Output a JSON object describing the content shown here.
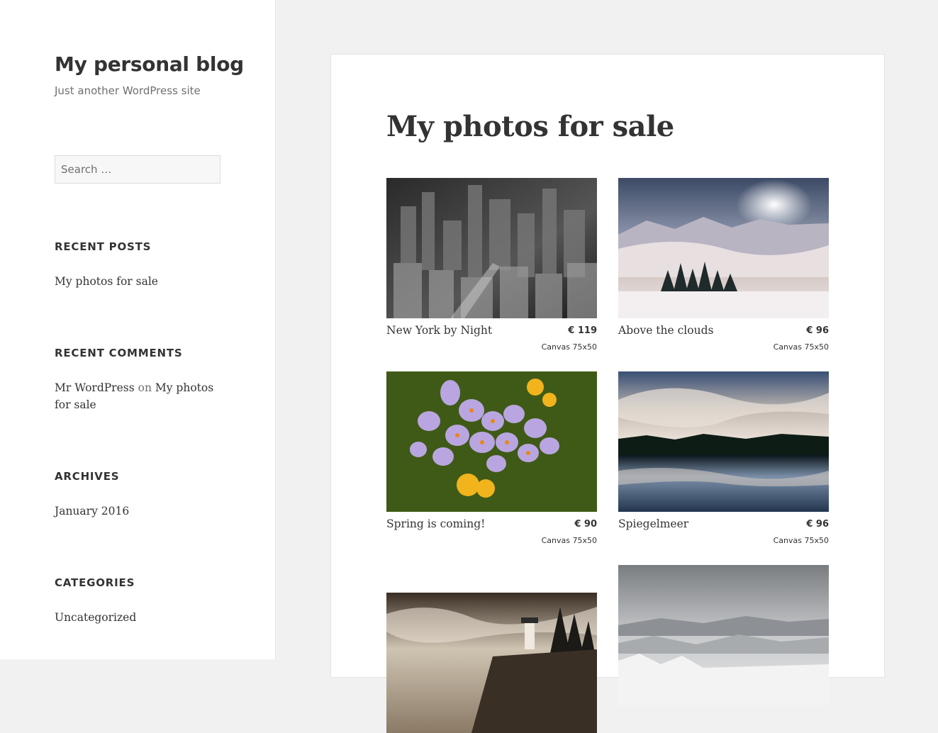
{
  "site": {
    "title": "My personal blog",
    "description": "Just another WordPress site"
  },
  "search": {
    "placeholder": "Search …"
  },
  "widgets": {
    "recent_posts": {
      "title": "RECENT POSTS",
      "items": [
        "My photos for sale"
      ]
    },
    "recent_comments": {
      "title": "RECENT COMMENTS",
      "author": "Mr WordPress",
      "on": "on",
      "post": "My photos",
      "post_cont": "for sale"
    },
    "archives": {
      "title": "ARCHIVES",
      "items": [
        "January 2016"
      ]
    },
    "categories": {
      "title": "CATEGORIES",
      "items": [
        "Uncategorized"
      ]
    }
  },
  "post": {
    "title": "My photos for sale",
    "products": [
      {
        "name": "New York by Night",
        "price": "€ 119",
        "variant": "Canvas 75x50"
      },
      {
        "name": "Above the clouds",
        "price": "€ 96",
        "variant": "Canvas 75x50"
      },
      {
        "name": "Spring is coming!",
        "price": "€ 90",
        "variant": "Canvas 75x50"
      },
      {
        "name": "Spiegelmeer",
        "price": "€ 96",
        "variant": "Canvas 75x50"
      },
      {
        "name": "",
        "price": "",
        "variant": ""
      },
      {
        "name": "",
        "price": "",
        "variant": ""
      }
    ]
  }
}
